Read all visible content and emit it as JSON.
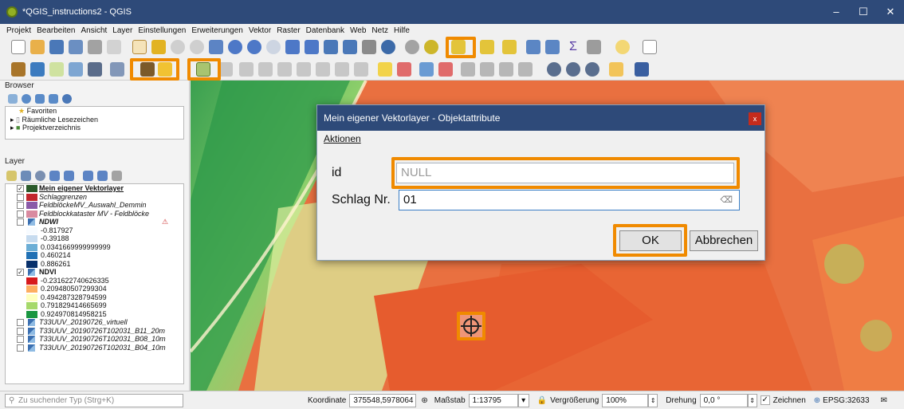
{
  "window": {
    "title": "*QGIS_instructions2 - QGIS",
    "minimize": "–",
    "maximize": "☐",
    "close": "✕"
  },
  "menu": [
    "Projekt",
    "Bearbeiten",
    "Ansicht",
    "Layer",
    "Einstellungen",
    "Erweiterungen",
    "Vektor",
    "Raster",
    "Datenbank",
    "Web",
    "Netz",
    "Hilfe"
  ],
  "browser": {
    "title": "Browser",
    "items": [
      {
        "label": "Favoriten",
        "icon": "star-icon"
      },
      {
        "label": "Räumliche Lesezeichen",
        "icon": "bookmark-icon"
      },
      {
        "label": "Projektverzeichnis",
        "icon": "folder-icon"
      }
    ]
  },
  "layers_panel": {
    "title": "Layer",
    "items": [
      {
        "label": "Mein eigener Vektorlayer",
        "checked": true,
        "bold": true,
        "swatch": "#2a5a2a"
      },
      {
        "label": "Schlaggrenzen",
        "checked": false,
        "italic": true,
        "swatch": "#c1272d"
      },
      {
        "label": "FeldblöckeMV_Auswahl_Demmin",
        "checked": false,
        "italic": true,
        "swatch": "#8a5aa8"
      },
      {
        "label": "Feldblockkataster MV - Feldblöcke",
        "checked": false,
        "italic": true,
        "swatch": "#d98aa0"
      },
      {
        "label": "NDWI",
        "checked": false,
        "italic": true,
        "bold": true,
        "warning": true
      },
      {
        "label": "-0.817927",
        "swatch": "#f7fbff",
        "legend": true
      },
      {
        "label": "-0.39188",
        "swatch": "#c6dbef",
        "legend": true
      },
      {
        "label": "0.0341669999999999",
        "swatch": "#6baed6",
        "legend": true
      },
      {
        "label": "0.460214",
        "swatch": "#2171b5",
        "legend": true
      },
      {
        "label": "0.886261",
        "swatch": "#08306b",
        "legend": true
      },
      {
        "label": "NDVI",
        "checked": true,
        "bold": true
      },
      {
        "label": "-0.231622740626335",
        "swatch": "#d7191c",
        "legend": true
      },
      {
        "label": "0.209480507299304",
        "swatch": "#fdae61",
        "legend": true
      },
      {
        "label": "0.494287328794599",
        "swatch": "#ffffbf",
        "legend": true
      },
      {
        "label": "0.791829414665699",
        "swatch": "#a6d96a",
        "legend": true
      },
      {
        "label": "0.924970814958215",
        "swatch": "#1a9641",
        "legend": true
      },
      {
        "label": "T33UUV_20190726_virtuell",
        "checked": false,
        "italic": true
      },
      {
        "label": "T33UUV_20190726T102031_B11_20m",
        "checked": false,
        "italic": true
      },
      {
        "label": "T33UUV_20190726T102031_B08_10m",
        "checked": false,
        "italic": true
      },
      {
        "label": "T33UUV_20190726T102031_B04_10m",
        "checked": false,
        "italic": true
      }
    ]
  },
  "dialog": {
    "title": "Mein eigener Vektorlayer - Objektattribute",
    "close": "x",
    "menu": "Aktionen",
    "fields": [
      {
        "label": "id",
        "value": "",
        "placeholder": "NULL"
      },
      {
        "label": "Schlag Nr.",
        "value": "01"
      }
    ],
    "ok": "OK",
    "cancel": "Abbrechen"
  },
  "status": {
    "search_placeholder": "Zu suchender Typ (Strg+K)",
    "coord_label": "Koordinate",
    "coord_value": "375548,5978064",
    "scale_label": "Maßstab",
    "scale_value": "1:13795",
    "magnifier_label": "Vergrößerung",
    "magnifier_value": "100%",
    "rotation_label": "Drehung",
    "rotation_value": "0,0 °",
    "render_label": "Zeichnen",
    "crs": "EPSG:32633"
  },
  "highlight_color": "#f08a00"
}
